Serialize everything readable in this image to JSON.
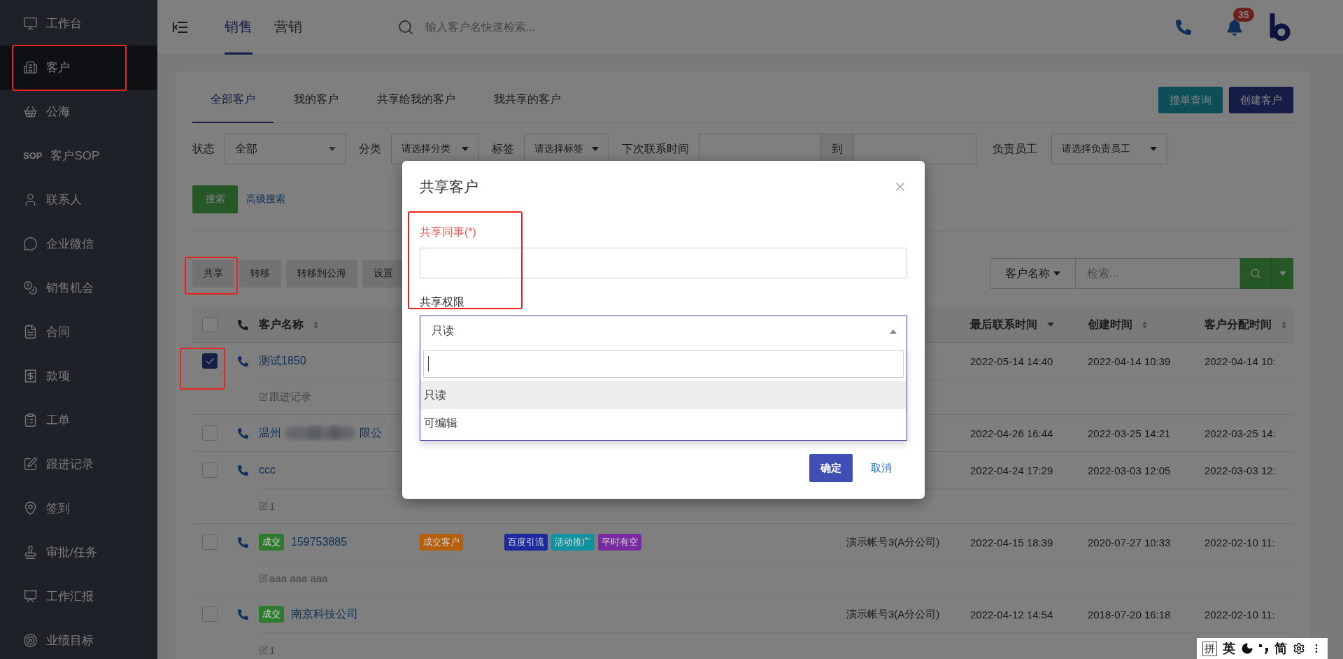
{
  "sidebar": {
    "items": [
      {
        "label": "工作台",
        "selected": false,
        "annotated": false
      },
      {
        "label": "客户",
        "selected": true,
        "annotated": true
      },
      {
        "label": "公海",
        "selected": false,
        "annotated": false
      },
      {
        "label": "客户SOP",
        "icon_text": "SOP",
        "selected": false,
        "annotated": false
      },
      {
        "label": "联系人",
        "selected": false,
        "annotated": false
      },
      {
        "label": "企业微信",
        "selected": false,
        "annotated": false
      },
      {
        "label": "销售机会",
        "selected": false,
        "annotated": false
      },
      {
        "label": "合同",
        "selected": false,
        "annotated": false
      },
      {
        "label": "款项",
        "selected": false,
        "annotated": false
      },
      {
        "label": "工单",
        "selected": false,
        "annotated": false
      },
      {
        "label": "跟进记录",
        "selected": false,
        "annotated": false
      },
      {
        "label": "签到",
        "selected": false,
        "annotated": false
      },
      {
        "label": "审批/任务",
        "selected": false,
        "annotated": false
      },
      {
        "label": "工作汇报",
        "selected": false,
        "annotated": false
      },
      {
        "label": "业绩目标",
        "selected": false,
        "annotated": false
      }
    ]
  },
  "topbar": {
    "tabs": [
      {
        "label": "销售",
        "selected": true
      },
      {
        "label": "营销",
        "selected": false
      }
    ],
    "search": {
      "placeholder": "输入客户名快速检索..."
    },
    "notification_count": "35"
  },
  "page": {
    "tabs": [
      {
        "label": "全部客户",
        "selected": true
      },
      {
        "label": "我的客户",
        "selected": false
      },
      {
        "label": "共享给我的客户",
        "selected": false
      },
      {
        "label": "我共享的客户",
        "selected": false
      }
    ],
    "buttons": [
      {
        "label": "撞单查询",
        "kind": "info"
      },
      {
        "label": "创建客户",
        "kind": "primary"
      }
    ],
    "filters": {
      "status": {
        "label": "状态",
        "value": "全部"
      },
      "category": {
        "label": "分类",
        "placeholder": "请选择分类"
      },
      "tag": {
        "label": "标签",
        "placeholder": "请选择标签"
      },
      "next_contact": {
        "label": "下次联系时间",
        "separator": "到"
      },
      "owner": {
        "label": "负责员工",
        "placeholder": "请选择负责员工"
      }
    },
    "search_button": "搜索",
    "advanced_search": "高级搜索",
    "actions": [
      {
        "label": "共享",
        "annotated": true
      },
      {
        "label": "转移",
        "annotated": false
      },
      {
        "label": "转移到公海",
        "annotated": false
      },
      {
        "label": "设置",
        "annotated": false
      }
    ],
    "quick_search": {
      "field": "客户名称",
      "placeholder": "检索..."
    }
  },
  "table": {
    "select_all": {
      "checked": false
    },
    "header": {
      "name": {
        "label": "客户名称",
        "sorted": false
      },
      "last_contact": {
        "label": "最后联系时间",
        "sorted": true
      },
      "created": {
        "label": "创建时间",
        "sorted": false
      },
      "assigned": {
        "label": "客户分配时间",
        "sorted": false
      }
    },
    "rows": [
      {
        "selected": true,
        "annotated": true,
        "name": "测试1850",
        "note": "跟进记录",
        "last_contact": "2022-05-14 14:40",
        "created": "2022-04-14 10:39",
        "assigned": "2022-04-14 10:"
      },
      {
        "selected": false,
        "annotated": false,
        "name": "温州",
        "redacted": true,
        "name_tail": "限公",
        "last_contact": "2022-04-26 16:44",
        "created": "2022-03-25 14:21",
        "assigned": "2022-03-25 14:"
      },
      {
        "selected": false,
        "annotated": false,
        "name": "ccc",
        "note": "1",
        "last_contact": "2022-04-24 17:29",
        "created": "2022-03-03 12:05",
        "assigned": "2022-03-03 12:"
      },
      {
        "selected": false,
        "annotated": false,
        "status_tag": {
          "label": "成交",
          "color": "#2f7a2f"
        },
        "name": "159753885",
        "category": {
          "label": "成交客户",
          "color": "#b35f0c"
        },
        "tags": [
          {
            "label": "百度引流",
            "color": "#1c2aa0"
          },
          {
            "label": "活动推广",
            "color": "#10939e"
          },
          {
            "label": "平时有空",
            "color": "#7a2aa0"
          }
        ],
        "owner": "演示帐号3(A分公司)",
        "note": "aaa aaa aaa",
        "last_contact": "2022-04-15 18:39",
        "created": "2020-07-27 10:33",
        "assigned": "2022-02-10 11:"
      },
      {
        "selected": false,
        "annotated": false,
        "status_tag": {
          "label": "成交",
          "color": "#2f7a2f"
        },
        "name": "南京科技公司",
        "owner": "演示帐号3(A分公司)",
        "note": "1",
        "last_contact": "2022-04-12 14:54",
        "created": "2018-07-20 16:18",
        "assigned": "2022-02-10 11:"
      }
    ]
  },
  "dialog": {
    "title": "共享客户",
    "annotated": true,
    "fields": [
      {
        "kind": "text",
        "label": "共享同事(*)",
        "required": true
      },
      {
        "kind": "select",
        "label": "共享权限",
        "required": false,
        "value": "只读",
        "expanded": true,
        "options": [
          {
            "label": "只读",
            "selected": true
          },
          {
            "label": "可编辑",
            "selected": false
          }
        ]
      }
    ],
    "buttons": [
      {
        "label": "确定",
        "kind": "primary"
      },
      {
        "label": "取消",
        "kind": "link"
      }
    ]
  },
  "ime_bar": {
    "items": [
      {
        "kind": "text",
        "label": "拼",
        "boxed": true
      },
      {
        "kind": "text",
        "label": "英",
        "boxed": false
      },
      {
        "kind": "moon"
      },
      {
        "kind": "punctuation"
      },
      {
        "kind": "text",
        "label": "简",
        "boxed": false
      },
      {
        "kind": "settings"
      },
      {
        "kind": "more"
      }
    ]
  }
}
